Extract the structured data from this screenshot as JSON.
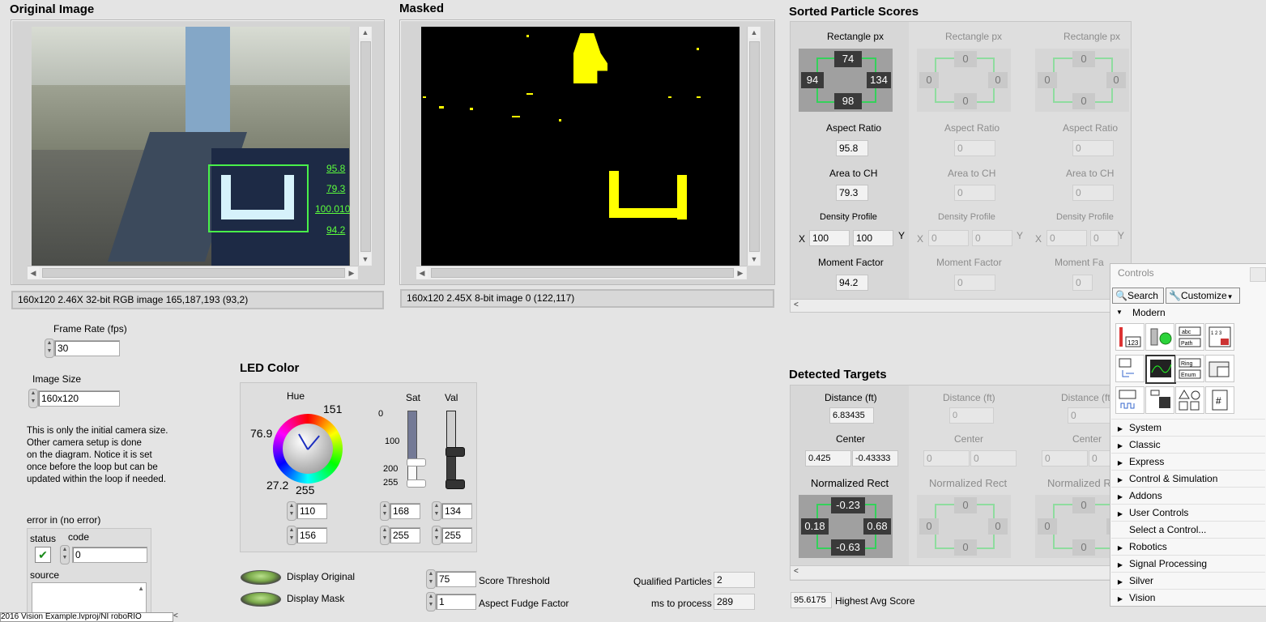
{
  "titles": {
    "original": "Original Image",
    "masked": "Masked",
    "sorted": "Sorted Particle Scores",
    "detected": "Detected Targets",
    "led": "LED Color"
  },
  "original_overlay_values": [
    "95.8",
    "79.3",
    "100.0100",
    "94.2"
  ],
  "original_status": "160x120 2.46X 32-bit RGB image 165,187,193    (93,2)",
  "masked_status": "160x120 2.45X 8-bit image 0    (122,117)",
  "frame_rate": {
    "label": "Frame Rate (fps)",
    "value": "30"
  },
  "image_size": {
    "label": "Image Size",
    "value": "160x120"
  },
  "note_lines": [
    "This is only the initial camera size.",
    "Other camera setup is done",
    "on the diagram. Notice it is set",
    "once before the loop but can be",
    "updated within the loop if needed."
  ],
  "error": {
    "label": "error in (no error)",
    "status_label": "status",
    "code_label": "code",
    "code_value": "0",
    "source_label": "source"
  },
  "led": {
    "hue_label": "Hue",
    "sat_label": "Sat",
    "val_label": "Val",
    "dial_labels": [
      "151",
      "76.9",
      "27.2",
      "255"
    ],
    "sat_ticks": [
      "0",
      "100",
      "200",
      "255"
    ],
    "hue_low": "110",
    "hue_high": "156",
    "sat_low": "168",
    "sat_high": "255",
    "val_low": "134",
    "val_high": "255"
  },
  "display_original": "Display Original",
  "display_mask": "Display Mask",
  "score_threshold": {
    "label": "Score Threshold",
    "value": "75"
  },
  "aspect_fudge": {
    "label": "Aspect Fudge Factor",
    "value": "1"
  },
  "qualified": {
    "label": "Qualified Particles",
    "value": "2"
  },
  "ms_process": {
    "label": "ms to process",
    "value": "289"
  },
  "scores": [
    {
      "rect_label": "Rectangle px",
      "top": "74",
      "left": "94",
      "right": "134",
      "bottom": "98",
      "aspect_label": "Aspect Ratio",
      "aspect": "95.8",
      "area_label": "Area to CH",
      "area": "79.3",
      "density_label": "Density Profile",
      "x_label": "X",
      "y_label": "Y",
      "dx": "100",
      "dy": "100",
      "moment_label": "Moment Factor",
      "moment": "94.2"
    },
    {
      "rect_label": "Rectangle px",
      "top": "0",
      "left": "0",
      "right": "0",
      "bottom": "0",
      "aspect_label": "Aspect Ratio",
      "aspect": "0",
      "area_label": "Area to CH",
      "area": "0",
      "density_label": "Density Profile",
      "x_label": "X",
      "y_label": "Y",
      "dx": "0",
      "dy": "0",
      "moment_label": "Moment Factor",
      "moment": "0"
    },
    {
      "rect_label": "Rectangle px",
      "top": "0",
      "left": "0",
      "right": "0",
      "bottom": "0",
      "aspect_label": "Aspect Ratio",
      "aspect": "0",
      "area_label": "Area to CH",
      "area": "0",
      "density_label": "Density Profile",
      "x_label": "X",
      "y_label": "Y",
      "dx": "0",
      "dy": "0",
      "moment_label": "Moment Fa",
      "moment": "0"
    }
  ],
  "targets": [
    {
      "dist_label": "Distance (ft)",
      "dist": "6.83435",
      "center_label": "Center",
      "cx": "0.425",
      "cy": "-0.43333",
      "norm_label": "Normalized Rect",
      "top": "-0.23",
      "left": "0.18",
      "right": "0.68",
      "bottom": "-0.63"
    },
    {
      "dist_label": "Distance (ft)",
      "dist": "0",
      "center_label": "Center",
      "cx": "0",
      "cy": "0",
      "norm_label": "Normalized Rect",
      "top": "0",
      "left": "0",
      "right": "0",
      "bottom": "0"
    },
    {
      "dist_label": "Distance (ft",
      "dist": "0",
      "center_label": "Center",
      "cx": "0",
      "cy": "0",
      "norm_label": "Normalized R",
      "top": "0",
      "left": "0",
      "right": "0",
      "bottom": "0"
    }
  ],
  "highest_avg": {
    "value": "95.6175",
    "label": "Highest Avg Score"
  },
  "controls_palette": {
    "title": "Controls",
    "search": "Search",
    "customize": "Customize",
    "modern": "Modern",
    "items": [
      "System",
      "Classic",
      "Express",
      "Control & Simulation",
      "Addons",
      "User Controls",
      "Select a Control...",
      "Robotics",
      "Signal Processing",
      "Silver",
      "Vision"
    ]
  },
  "taskbar": "2016 Vision Example.lvproj/NI roboRIO"
}
